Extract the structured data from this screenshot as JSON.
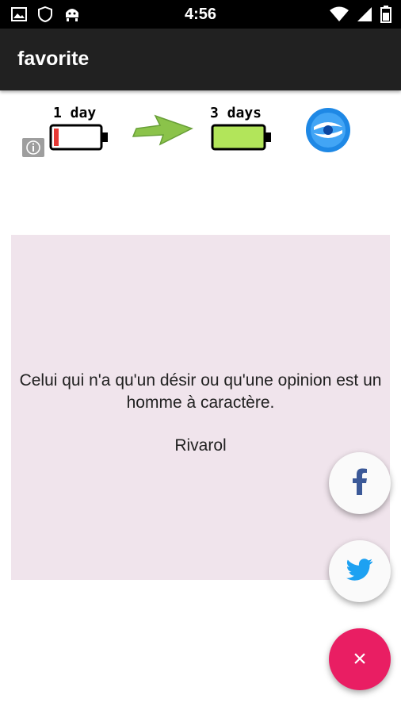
{
  "status_bar": {
    "time": "4:56",
    "left_icons": [
      "image-icon",
      "shield-icon",
      "android-icon"
    ],
    "right_icons": [
      "wifi-icon",
      "signal-icon",
      "battery-icon"
    ]
  },
  "app_bar": {
    "title": "favorite"
  },
  "ad_banner": {
    "label_before": "1 day",
    "label_after": "3 days",
    "icons": [
      "info-icon",
      "battery-low-icon",
      "arrow-right-icon",
      "battery-full-icon",
      "app-logo-icon"
    ],
    "colors": {
      "battery_low": "#e53935",
      "battery_full": "#b2e55a",
      "arrow": "#8bc34a",
      "logo": "#1e88e5"
    }
  },
  "quote": {
    "text": "Celui qui n'a qu'un désir ou qu'une opinion est un homme à caractère.",
    "author": "Rivarol"
  },
  "fabs": {
    "facebook_icon": "facebook-icon",
    "twitter_icon": "twitter-icon",
    "close_label": "×"
  },
  "colors": {
    "app_bar": "#212121",
    "status_bar": "#000000",
    "card_bg": "#f0e4ec",
    "fab_accent": "#e91e63",
    "facebook": "#3b5998",
    "twitter": "#1da1f2"
  }
}
